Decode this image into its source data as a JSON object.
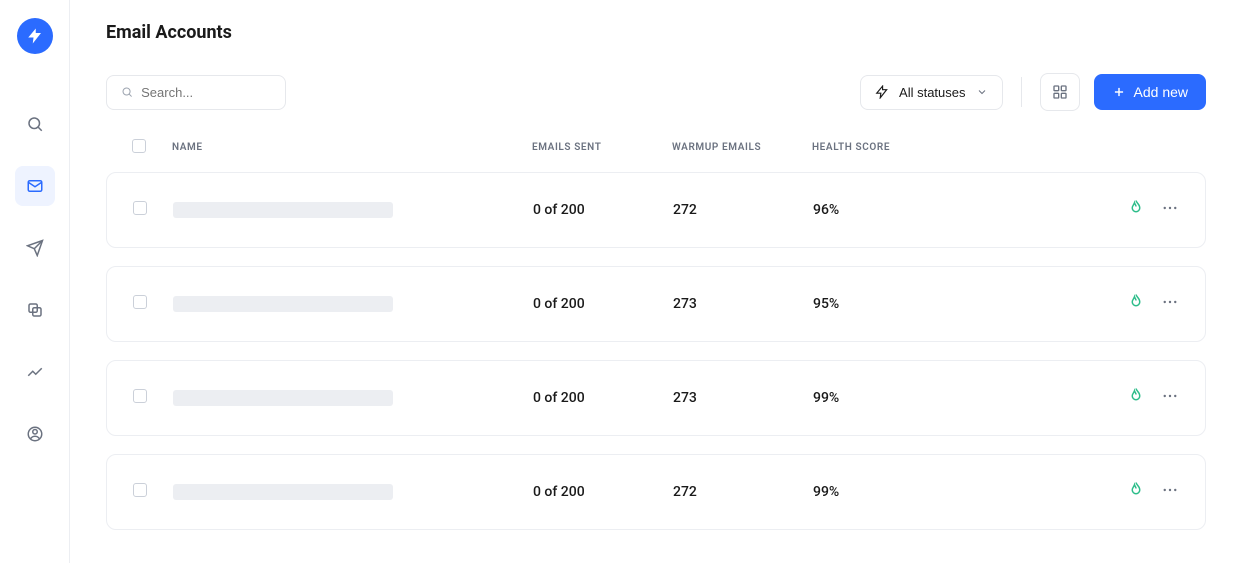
{
  "page_title": "Email Accounts",
  "search": {
    "placeholder": "Search..."
  },
  "filter": {
    "label": "All statuses"
  },
  "add_button": {
    "label": "Add new"
  },
  "columns": {
    "name": "NAME",
    "emails_sent": "EMAILS SENT",
    "warmup_emails": "WARMUP EMAILS",
    "health_score": "HEALTH SCORE"
  },
  "rows": [
    {
      "emails_sent": "0  of  200",
      "warmup_emails": "272",
      "health_score": "96%"
    },
    {
      "emails_sent": "0  of  200",
      "warmup_emails": "273",
      "health_score": "95%"
    },
    {
      "emails_sent": "0  of  200",
      "warmup_emails": "273",
      "health_score": "99%"
    },
    {
      "emails_sent": "0  of  200",
      "warmup_emails": "272",
      "health_score": "99%"
    }
  ]
}
